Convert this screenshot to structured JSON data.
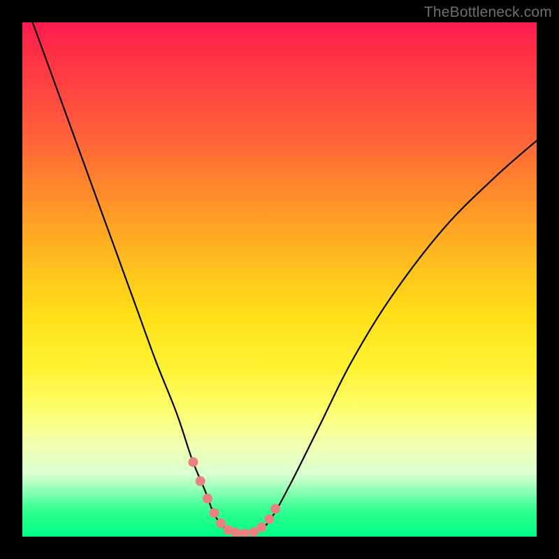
{
  "watermark": "TheBottleneck.com",
  "chart_data": {
    "type": "line",
    "title": "",
    "xlabel": "",
    "ylabel": "",
    "xlim": [
      0,
      100
    ],
    "ylim": [
      0,
      100
    ],
    "grid": false,
    "series": [
      {
        "name": "curve",
        "x": [
          2,
          6,
          10,
          14,
          18,
          22,
          26,
          30,
          33,
          35.5,
          37,
          38.5,
          40,
          41,
          42,
          44,
          45.5,
          48,
          52,
          58,
          64,
          72,
          82,
          92,
          100
        ],
        "y": [
          100,
          89,
          78,
          67,
          56,
          45,
          34,
          24,
          15,
          9,
          5,
          2.5,
          1.2,
          0.8,
          0.6,
          0.6,
          1,
          3,
          10,
          22,
          34,
          47,
          60,
          70,
          77
        ]
      }
    ],
    "markers": {
      "name": "highlighted-points",
      "color": "#e9827e",
      "radius_pct": 0.95,
      "x": [
        33.2,
        34.6,
        36.0,
        37.3,
        38.6,
        40.0,
        41.5,
        43.2,
        45.0,
        46.5,
        48.0,
        49.2
      ],
      "y": [
        14.5,
        10.8,
        7.4,
        4.6,
        2.6,
        1.3,
        0.8,
        0.6,
        0.9,
        1.8,
        3.4,
        5.4
      ]
    },
    "background_gradient": {
      "direction": "vertical",
      "stops": [
        {
          "pos": 0.0,
          "color": "#ff1a50"
        },
        {
          "pos": 0.5,
          "color": "#ffd020"
        },
        {
          "pos": 0.8,
          "color": "#fdff72"
        },
        {
          "pos": 1.0,
          "color": "#00ff84"
        }
      ]
    }
  }
}
